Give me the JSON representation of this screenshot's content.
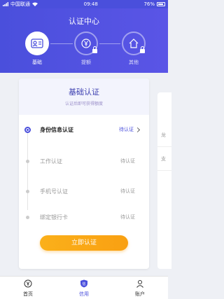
{
  "status_bar": {
    "carrier": "中国联通",
    "time": "09:48",
    "battery": "76%"
  },
  "header": {
    "title": "认证中心"
  },
  "steps": [
    {
      "label": "基础",
      "icon": "id-card-icon",
      "active": true
    },
    {
      "label": "提额",
      "icon": "yen-circle-icon",
      "active": false
    },
    {
      "label": "其他",
      "icon": "house-icon",
      "active": false
    }
  ],
  "card": {
    "title": "基础认证",
    "subtitle": "认证后即可获得额度",
    "items": [
      {
        "name": "身份信息认证",
        "status": "待认证"
      },
      {
        "name": "工作认证",
        "status": "待认证"
      },
      {
        "name": "手机号认证",
        "status": "待认证"
      },
      {
        "name": "绑定银行卡",
        "status": "待认证"
      }
    ],
    "cta": "立即认证"
  },
  "side_card": {
    "texts": [
      "龙",
      "支"
    ]
  },
  "tabbar": {
    "items": [
      {
        "label": "首页",
        "icon": "yen-icon"
      },
      {
        "label": "信用",
        "icon": "shield-credit-icon"
      },
      {
        "label": "账户",
        "icon": "user-icon"
      }
    ]
  },
  "colors": {
    "primary": "#4a4fdc",
    "accent": "#f9a012"
  }
}
